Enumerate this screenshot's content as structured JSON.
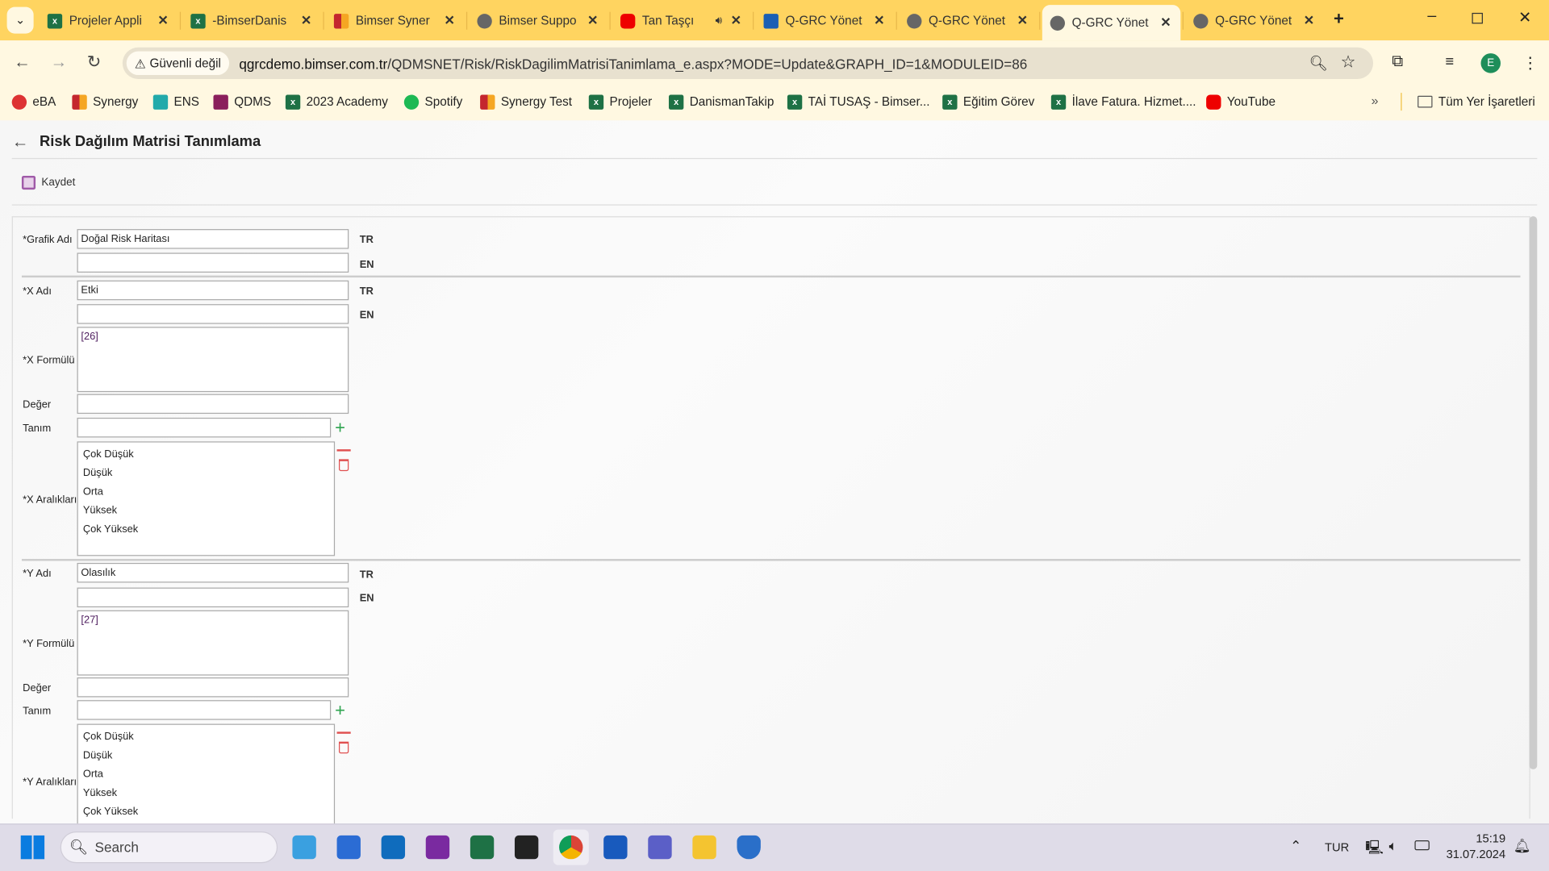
{
  "browser": {
    "tabs": [
      {
        "title": "Projeler Appli",
        "icon": "excel-icon"
      },
      {
        "title": "-BimserDanis",
        "icon": "excel-icon"
      },
      {
        "title": "Bimser Syner",
        "icon": "synergy-icon"
      },
      {
        "title": "Bimser Suppo",
        "icon": "globe-icon"
      },
      {
        "title": "Tan Taşçı",
        "icon": "youtube-icon",
        "audio": true
      },
      {
        "title": "Q-GRC Yönet",
        "icon": "qdms-icon"
      },
      {
        "title": "Q-GRC Yönet",
        "icon": "globe-icon"
      },
      {
        "title": "Q-GRC Yönet",
        "icon": "globe-icon",
        "active": true
      },
      {
        "title": "Q-GRC Yönet",
        "icon": "globe-icon"
      }
    ],
    "security_label": "Güvenli değil",
    "url_host": "qgrcdemo.bimser.com.tr",
    "url_path": "/QDMSNET/Risk/RiskDagilimMatrisiTanimlama_e.aspx?MODE=Update&GRAPH_ID=1&MODULEID=86",
    "profile_initial": "E",
    "bookmarks": [
      {
        "label": "eBA",
        "icon": "eba-icon"
      },
      {
        "label": "Synergy",
        "icon": "synergy-icon"
      },
      {
        "label": "ENS",
        "icon": "ens-icon"
      },
      {
        "label": "QDMS",
        "icon": "qdms-icon"
      },
      {
        "label": "2023 Academy",
        "icon": "excel-icon"
      },
      {
        "label": "Spotify",
        "icon": "spotify-icon"
      },
      {
        "label": "Synergy Test",
        "icon": "synergy-icon"
      },
      {
        "label": "Projeler",
        "icon": "excel-icon"
      },
      {
        "label": "DanismanTakip",
        "icon": "excel-icon"
      },
      {
        "label": "TAİ TUSAŞ - Bimser...",
        "icon": "excel-icon"
      },
      {
        "label": "Eğitim Görev",
        "icon": "excel-icon"
      },
      {
        "label": "İlave Fatura. Hizmet....",
        "icon": "excel-icon"
      },
      {
        "label": "YouTube",
        "icon": "youtube-icon"
      }
    ],
    "all_bookmarks": "Tüm Yer İşaretleri"
  },
  "page": {
    "title": "Risk Dağılım Matrisi Tanımlama",
    "save_label": "Kaydet",
    "form": {
      "grafik_adi_label": "*Grafik Adı",
      "grafik_adi_tr": "Doğal Risk Haritası",
      "grafik_adi_en": "",
      "lang_tr": "TR",
      "lang_en": "EN",
      "x_adi_label": "*X Adı",
      "x_adi_tr": "Etki",
      "x_adi_en": "",
      "x_formul_label": "*X Formülü",
      "x_formul": "[26]",
      "deger_label": "Değer",
      "tanim_label": "Tanım",
      "x_deger": "",
      "x_tanim": "",
      "x_araliklar_label": "*X Aralıkları",
      "x_araliklar": [
        "Çok Düşük",
        "Düşük",
        "Orta",
        "Yüksek",
        "Çok Yüksek"
      ],
      "y_adi_label": "*Y Adı",
      "y_adi_tr": "Olasılık",
      "y_adi_en": "",
      "y_formul_label": "*Y Formülü",
      "y_formul": "[27]",
      "y_deger": "",
      "y_tanim": "",
      "y_araliklar_label": "*Y Aralıkları",
      "y_araliklar": [
        "Çok Düşük",
        "Düşük",
        "Orta",
        "Yüksek",
        "Çok Yüksek"
      ]
    }
  },
  "taskbar": {
    "search_placeholder": "Search",
    "language": "TUR",
    "time": "15:19",
    "date": "31.07.2024"
  }
}
